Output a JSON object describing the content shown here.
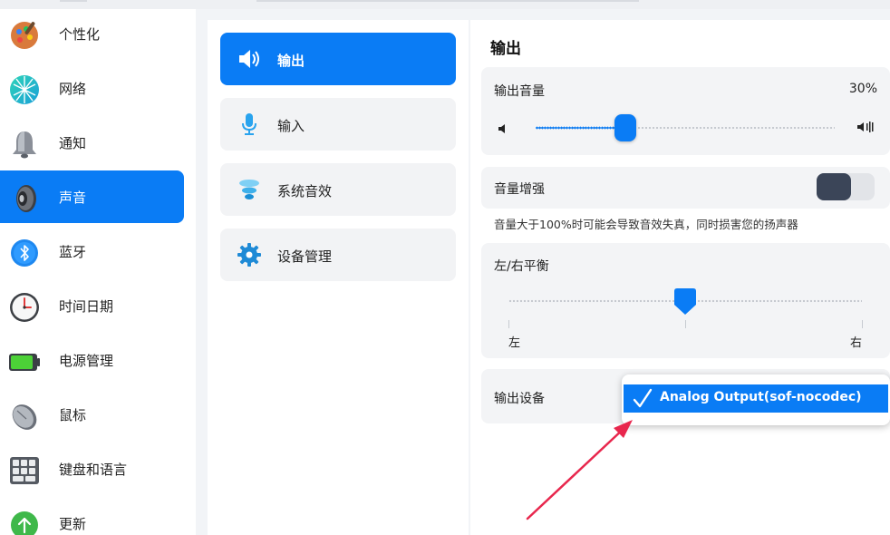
{
  "sidebar": {
    "items": [
      {
        "label": "个性化",
        "icon": "palette-icon"
      },
      {
        "label": "网络",
        "icon": "network-icon"
      },
      {
        "label": "通知",
        "icon": "bell-icon"
      },
      {
        "label": "声音",
        "icon": "speaker-icon",
        "active": true
      },
      {
        "label": "蓝牙",
        "icon": "bluetooth-icon"
      },
      {
        "label": "时间日期",
        "icon": "clock-icon"
      },
      {
        "label": "电源管理",
        "icon": "battery-icon"
      },
      {
        "label": "鼠标",
        "icon": "mouse-icon"
      },
      {
        "label": "键盘和语言",
        "icon": "keyboard-icon"
      },
      {
        "label": "更新",
        "icon": "update-arrow-icon"
      }
    ]
  },
  "subnav": {
    "items": [
      {
        "label": "输出",
        "icon": "speaker-output-icon",
        "active": true
      },
      {
        "label": "输入",
        "icon": "microphone-icon"
      },
      {
        "label": "系统音效",
        "icon": "sound-effects-icon"
      },
      {
        "label": "设备管理",
        "icon": "gear-icon"
      }
    ]
  },
  "output": {
    "title": "输出",
    "volume": {
      "label": "输出音量",
      "value_text": "30%",
      "level": 0.3
    },
    "boost": {
      "label": "音量增强",
      "enabled": false,
      "note": "音量大于100%时可能会导致音效失真，同时损害您的扬声器"
    },
    "balance": {
      "label": "左/右平衡",
      "left_label": "左",
      "right_label": "右",
      "position": 0.5
    },
    "device": {
      "label": "输出设备",
      "selected": "Analog Output(sof-nocodec)"
    }
  },
  "colors": {
    "accent": "#0a7cf5",
    "annotation_arrow": "#e8274d"
  }
}
